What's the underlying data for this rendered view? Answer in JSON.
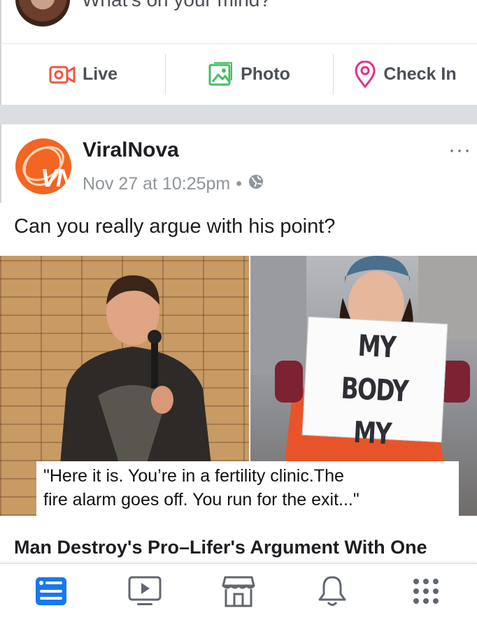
{
  "composer": {
    "prompt": "What's on your mind?",
    "actions": [
      {
        "label": "Live",
        "icon": "live-video-icon",
        "color": "#f5533d"
      },
      {
        "label": "Photo",
        "icon": "photo-icon",
        "color": "#45bd62"
      },
      {
        "label": "Check In",
        "icon": "location-pin-icon",
        "color": "#e42f8a"
      }
    ]
  },
  "post": {
    "page_name": "ViralNova",
    "timestamp": "Nov 27 at 10:25pm",
    "separator": "•",
    "privacy_icon": "globe-icon",
    "more_label": "···",
    "text": "Can you really argue with his point?",
    "image": {
      "sign_line1": "MY BODY",
      "sign_line2": "MY CHOICE",
      "caption_line1": "\"Here it is. You’re in a fertility clinic.The",
      "caption_line2": "fire alarm goes off. You run for the exit...\""
    },
    "link_title": "Man Destroy's Pro–Lifer's Argument With One"
  },
  "tabbar": {
    "tabs": [
      {
        "name": "news-feed",
        "icon": "news-feed-icon",
        "active": true
      },
      {
        "name": "watch",
        "icon": "video-play-icon",
        "active": false
      },
      {
        "name": "marketplace",
        "icon": "marketplace-icon",
        "active": false
      },
      {
        "name": "notifications",
        "icon": "bell-icon",
        "active": false
      },
      {
        "name": "menu",
        "icon": "menu-grid-icon",
        "active": false
      }
    ],
    "active_color": "#1877f2",
    "inactive_color": "#606770"
  }
}
